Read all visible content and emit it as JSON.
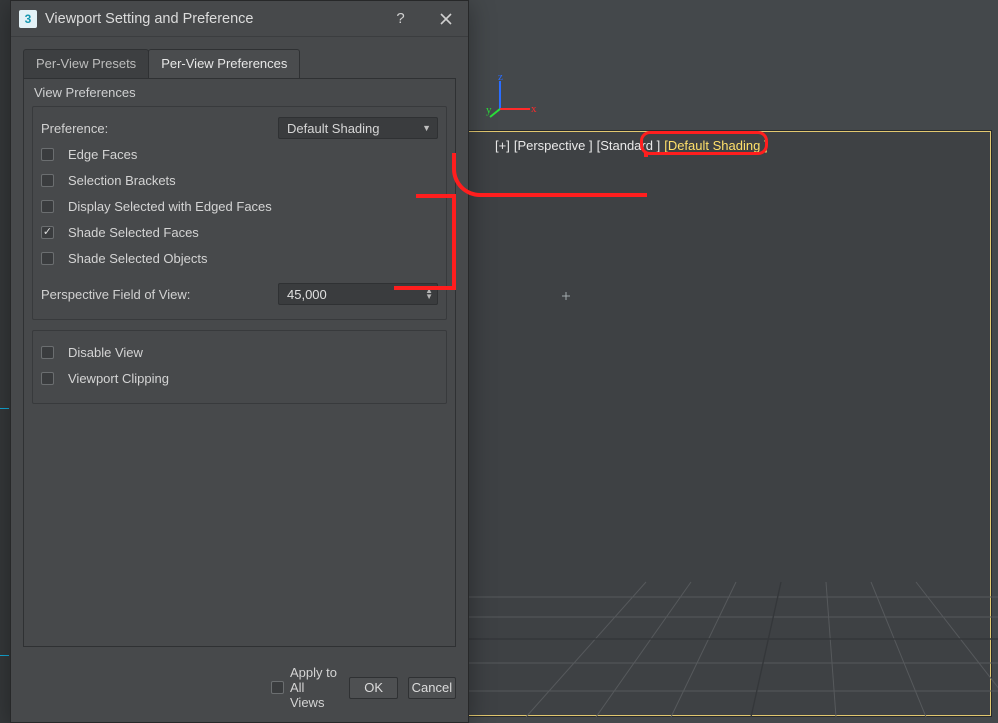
{
  "dialog": {
    "title": "Viewport Setting and Preference",
    "app_icon_text": "3",
    "tabs": {
      "presets": "Per-View Presets",
      "prefs": "Per-View Preferences"
    },
    "panel_title": "View Preferences",
    "preference_label": "Preference:",
    "preference_value": "Default Shading",
    "options": {
      "edge_faces": "Edge Faces",
      "selection_brackets": "Selection Brackets",
      "display_selected_edged": "Display Selected with Edged Faces",
      "shade_selected_faces": "Shade Selected Faces",
      "shade_selected_objects": "Shade Selected Objects"
    },
    "fov_label": "Perspective Field of View:",
    "fov_value": "45,000",
    "disable_view": "Disable View",
    "viewport_clipping": "Viewport Clipping",
    "apply_all": "Apply to All Views",
    "ok": "OK",
    "cancel": "Cancel"
  },
  "viewport": {
    "plus": "[+]",
    "view": "[Perspective ]",
    "quality": "[Standard ]",
    "shading": "[Default Shading ]",
    "axis_z": "z",
    "axis_y": "y",
    "axis_x": "x"
  }
}
